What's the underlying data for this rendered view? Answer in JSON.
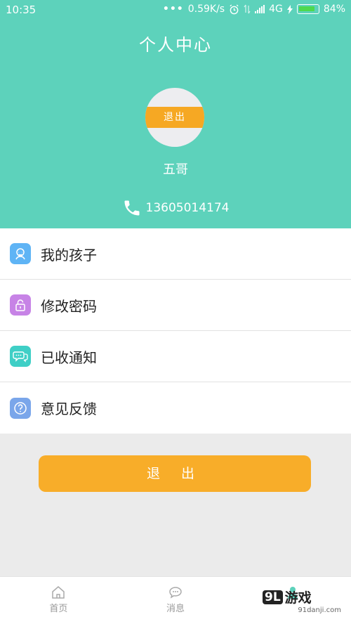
{
  "status_bar": {
    "time": "10:35",
    "network_speed": "0.59K/s",
    "network_type": "4G",
    "battery_percent": "84%",
    "battery_level": 0.84
  },
  "header": {
    "title": "个人中心",
    "avatar_badge": "退出",
    "username": "五哥",
    "phone": "13605014174"
  },
  "menu": [
    {
      "label": "我的孩子",
      "icon": "child-icon",
      "color": "#5fb4f5"
    },
    {
      "label": "修改密码",
      "icon": "lock-icon",
      "color": "#c783e6"
    },
    {
      "label": "已收通知",
      "icon": "chat-icon",
      "color": "#3fcfc6"
    },
    {
      "label": "意见反馈",
      "icon": "question-icon",
      "color": "#7aa6ea"
    }
  ],
  "logout_button": "退 出",
  "tabbar": [
    {
      "label": "首页",
      "icon": "home-icon"
    },
    {
      "label": "消息",
      "icon": "message-icon"
    },
    {
      "label": "",
      "icon": "person-icon"
    }
  ],
  "watermark": {
    "logo": "9L",
    "text": "游戏",
    "sub": "91danji.com"
  },
  "colors": {
    "primary": "#5dd2bb",
    "accent": "#f8ad29"
  }
}
